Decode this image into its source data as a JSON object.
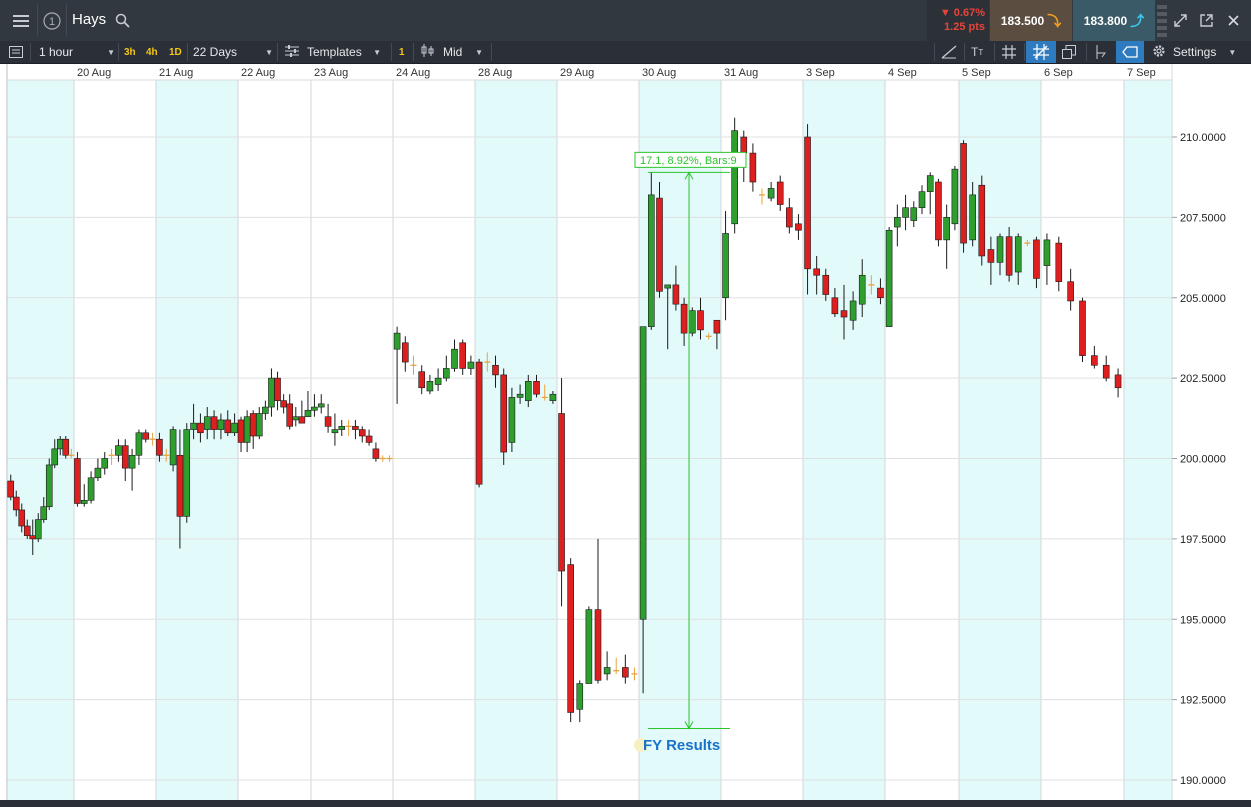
{
  "header": {
    "title": "Hays",
    "change_pct": "0.67%",
    "change_pts": "1.25 pts",
    "sell_price": "183.500",
    "buy_price": "183.800"
  },
  "toolbar": {
    "interval": "1 hour",
    "quick_3h": "3h",
    "quick_4h": "4h",
    "quick_1d": "1D",
    "range": "22 Days",
    "templates": "Templates",
    "count_badge": "1",
    "price_type": "Mid",
    "settings": "Settings"
  },
  "chart_data": {
    "type": "candlestick",
    "x_labels": [
      "20 Aug",
      "21 Aug",
      "22 Aug",
      "23 Aug",
      "24 Aug",
      "28 Aug",
      "29 Aug",
      "30 Aug",
      "31 Aug",
      "3 Sep",
      "4 Sep",
      "5 Sep",
      "6 Sep",
      "7 Sep"
    ],
    "y_ticks": [
      "190.0000",
      "192.5000",
      "195.0000",
      "197.5000",
      "200.0000",
      "202.5000",
      "205.0000",
      "207.5000",
      "210.0000"
    ],
    "ylim": [
      189.8,
      211.5
    ],
    "measure_label": "17.1, 8.92%, Bars:9",
    "event_label": "FY Results",
    "colors": {
      "up": "#2e9e2e",
      "down": "#dd1f1f",
      "doji": "#e8a33d",
      "measure": "#2bc42b",
      "event": "#1a73c9",
      "band": "#e3fafb"
    },
    "candles": [
      [
        199.3,
        198.8,
        199.5,
        198.7
      ],
      [
        198.8,
        198.4,
        199.0,
        198.2
      ],
      [
        198.4,
        197.9,
        198.6,
        197.7
      ],
      [
        197.9,
        197.6,
        198.1,
        197.5
      ],
      [
        197.6,
        197.5,
        198.1,
        197.0
      ],
      [
        197.5,
        198.1,
        198.3,
        197.4
      ],
      [
        198.1,
        198.5,
        198.8,
        198.0
      ],
      [
        198.5,
        199.8,
        200.0,
        198.4
      ],
      [
        199.8,
        200.3,
        200.6,
        199.7
      ],
      [
        200.3,
        200.6,
        200.7,
        200.1
      ],
      [
        200.6,
        200.1,
        200.7,
        200.0
      ],
      [
        200.1,
        200.1,
        200.3,
        200.0
      ],
      [
        200.0,
        198.6,
        200.2,
        198.5
      ],
      [
        198.6,
        198.7,
        199.2,
        198.5
      ],
      [
        198.7,
        199.4,
        199.6,
        198.6
      ],
      [
        199.4,
        199.7,
        200.0,
        199.3
      ],
      [
        199.7,
        200.0,
        200.2,
        199.5
      ],
      [
        200.1,
        200.1,
        200.3,
        199.8
      ],
      [
        200.1,
        200.4,
        200.6,
        199.9
      ],
      [
        200.4,
        199.7,
        200.6,
        199.3
      ],
      [
        199.7,
        200.1,
        200.3,
        199.0
      ],
      [
        200.1,
        200.8,
        200.9,
        199.8
      ],
      [
        200.8,
        200.6,
        200.9,
        200.5
      ],
      [
        200.6,
        200.6,
        200.8,
        200.4
      ],
      [
        200.6,
        200.1,
        200.8,
        199.9
      ],
      [
        200.1,
        200.1,
        200.3,
        199.9
      ],
      [
        199.8,
        200.9,
        201.0,
        199.6
      ],
      [
        200.1,
        198.2,
        200.9,
        197.2
      ],
      [
        198.2,
        200.9,
        201.1,
        198.0
      ],
      [
        200.9,
        201.1,
        201.7,
        200.6
      ],
      [
        201.1,
        200.8,
        201.4,
        200.5
      ],
      [
        200.9,
        201.3,
        201.6,
        200.6
      ],
      [
        201.3,
        200.9,
        201.5,
        200.6
      ],
      [
        200.9,
        201.2,
        201.4,
        200.6
      ],
      [
        201.2,
        200.8,
        201.5,
        200.7
      ],
      [
        200.8,
        201.1,
        201.4,
        200.7
      ],
      [
        201.2,
        200.5,
        201.3,
        200.2
      ],
      [
        200.5,
        201.3,
        201.5,
        200.2
      ],
      [
        201.4,
        200.7,
        201.5,
        200.3
      ],
      [
        200.7,
        201.4,
        201.6,
        200.6
      ],
      [
        201.4,
        201.6,
        201.8,
        201.2
      ],
      [
        201.6,
        202.5,
        202.8,
        201.3
      ],
      [
        202.5,
        201.8,
        202.7,
        201.5
      ],
      [
        201.8,
        201.6,
        202.0,
        201.4
      ],
      [
        201.7,
        201.0,
        202.0,
        200.9
      ],
      [
        201.2,
        201.3,
        201.6,
        201.0
      ],
      [
        201.3,
        201.1,
        201.8,
        201.1
      ],
      [
        201.3,
        201.5,
        202.1,
        201.3
      ],
      [
        201.5,
        201.6,
        202.0,
        201.3
      ],
      [
        201.6,
        201.7,
        202.0,
        201.4
      ],
      [
        201.3,
        201.0,
        201.7,
        200.8
      ],
      [
        200.8,
        200.9,
        201.4,
        200.4
      ],
      [
        200.9,
        201.0,
        201.2,
        200.7
      ],
      [
        201.0,
        201.0,
        201.2,
        200.7
      ],
      [
        201.0,
        200.9,
        201.2,
        200.6
      ],
      [
        200.9,
        200.7,
        201.0,
        200.5
      ],
      [
        200.7,
        200.5,
        200.9,
        200.4
      ],
      [
        200.3,
        200.0,
        200.5,
        199.9
      ],
      [
        200.0,
        200.0,
        200.1,
        199.9
      ],
      [
        200.0,
        200.0,
        200.1,
        199.9
      ],
      [
        203.4,
        203.9,
        204.1,
        201.7
      ],
      [
        203.6,
        203.0,
        203.8,
        202.7
      ],
      [
        202.9,
        202.9,
        203.2,
        202.6
      ],
      [
        202.7,
        202.2,
        202.9,
        202.0
      ],
      [
        202.1,
        202.4,
        202.6,
        202.0
      ],
      [
        202.3,
        202.5,
        202.8,
        202.1
      ],
      [
        202.5,
        202.8,
        203.2,
        202.4
      ],
      [
        202.8,
        203.4,
        203.7,
        202.7
      ],
      [
        203.6,
        202.8,
        203.7,
        202.6
      ],
      [
        202.8,
        203.0,
        203.2,
        202.6
      ],
      [
        203.0,
        199.2,
        203.1,
        199.1
      ],
      [
        203.0,
        203.0,
        203.3,
        202.7
      ],
      [
        202.9,
        202.6,
        203.2,
        202.2
      ],
      [
        202.6,
        200.2,
        202.8,
        199.8
      ],
      [
        200.5,
        201.9,
        202.2,
        200.2
      ],
      [
        201.9,
        202.0,
        202.3,
        201.7
      ],
      [
        201.8,
        202.4,
        202.6,
        201.6
      ],
      [
        202.4,
        202.0,
        202.6,
        201.9
      ],
      [
        201.9,
        201.9,
        202.3,
        201.8
      ],
      [
        201.8,
        202.0,
        202.1,
        201.7
      ],
      [
        201.4,
        196.5,
        202.5,
        195.4
      ],
      [
        196.7,
        192.1,
        196.9,
        191.8
      ],
      [
        192.2,
        193.0,
        193.1,
        191.8
      ],
      [
        193.0,
        195.3,
        195.4,
        193.0
      ],
      [
        195.3,
        193.1,
        197.5,
        193.0
      ],
      [
        193.3,
        193.5,
        194.0,
        193.1
      ],
      [
        193.4,
        193.4,
        193.8,
        193.3
      ],
      [
        193.5,
        193.2,
        193.9,
        193.0
      ],
      [
        193.3,
        193.3,
        193.5,
        193.1
      ],
      [
        195.0,
        204.1,
        204.1,
        192.7
      ],
      [
        204.1,
        208.2,
        208.9,
        204.0
      ],
      [
        208.1,
        205.2,
        208.6,
        205.0
      ],
      [
        205.3,
        205.4,
        205.4,
        203.4
      ],
      [
        205.4,
        204.8,
        206.0,
        204.6
      ],
      [
        204.8,
        203.9,
        205.0,
        203.5
      ],
      [
        203.9,
        204.6,
        204.7,
        203.8
      ],
      [
        204.6,
        204.0,
        205.0,
        203.7
      ],
      [
        203.8,
        203.8,
        203.9,
        203.7
      ],
      [
        204.3,
        203.9,
        204.3,
        203.4
      ],
      [
        205.0,
        207.0,
        207.7,
        204.3
      ],
      [
        207.3,
        210.2,
        210.6,
        207.0
      ],
      [
        210.0,
        209.5,
        210.2,
        208.6
      ],
      [
        209.5,
        208.6,
        209.8,
        208.3
      ],
      [
        208.2,
        208.2,
        208.4,
        207.9
      ],
      [
        208.1,
        208.4,
        208.6,
        208.0
      ],
      [
        208.6,
        207.9,
        208.8,
        207.7
      ],
      [
        207.8,
        207.2,
        208.1,
        207.0
      ],
      [
        207.3,
        207.1,
        207.6,
        206.8
      ],
      [
        210.0,
        205.9,
        210.4,
        205.1
      ],
      [
        205.9,
        205.7,
        206.3,
        205.1
      ],
      [
        205.7,
        205.1,
        205.9,
        204.9
      ],
      [
        205.0,
        204.5,
        205.3,
        204.4
      ],
      [
        204.6,
        204.4,
        205.4,
        203.7
      ],
      [
        204.3,
        204.9,
        205.2,
        204.0
      ],
      [
        204.8,
        205.7,
        206.2,
        204.4
      ],
      [
        205.4,
        205.4,
        205.7,
        205.1
      ],
      [
        205.3,
        205.0,
        205.6,
        204.8
      ],
      [
        204.1,
        207.1,
        207.2,
        204.1
      ],
      [
        207.2,
        207.5,
        207.9,
        206.6
      ],
      [
        207.5,
        207.8,
        208.2,
        207.1
      ],
      [
        207.4,
        207.8,
        208.0,
        207.2
      ],
      [
        207.8,
        208.3,
        208.5,
        207.6
      ],
      [
        208.3,
        208.8,
        208.9,
        207.6
      ],
      [
        208.6,
        206.8,
        208.7,
        206.6
      ],
      [
        206.8,
        207.5,
        207.9,
        205.9
      ],
      [
        207.3,
        209.0,
        209.1,
        207.1
      ],
      [
        209.8,
        206.7,
        209.9,
        206.4
      ],
      [
        206.8,
        208.2,
        208.6,
        206.6
      ],
      [
        208.5,
        206.3,
        208.8,
        206.0
      ],
      [
        206.5,
        206.1,
        206.9,
        205.4
      ],
      [
        206.1,
        206.9,
        207.0,
        205.7
      ],
      [
        206.9,
        205.7,
        207.2,
        205.5
      ],
      [
        205.8,
        206.9,
        207.0,
        205.4
      ],
      [
        206.7,
        206.7,
        206.8,
        206.6
      ],
      [
        206.8,
        205.6,
        206.9,
        205.3
      ],
      [
        206.0,
        206.8,
        207.0,
        205.4
      ],
      [
        206.7,
        205.5,
        206.9,
        205.2
      ],
      [
        205.5,
        204.9,
        205.9,
        204.6
      ],
      [
        204.9,
        203.2,
        205.0,
        203.0
      ],
      [
        203.2,
        202.9,
        203.5,
        202.8
      ],
      [
        202.9,
        202.5,
        203.2,
        202.4
      ],
      [
        202.6,
        202.2,
        202.8,
        201.9
      ]
    ]
  }
}
